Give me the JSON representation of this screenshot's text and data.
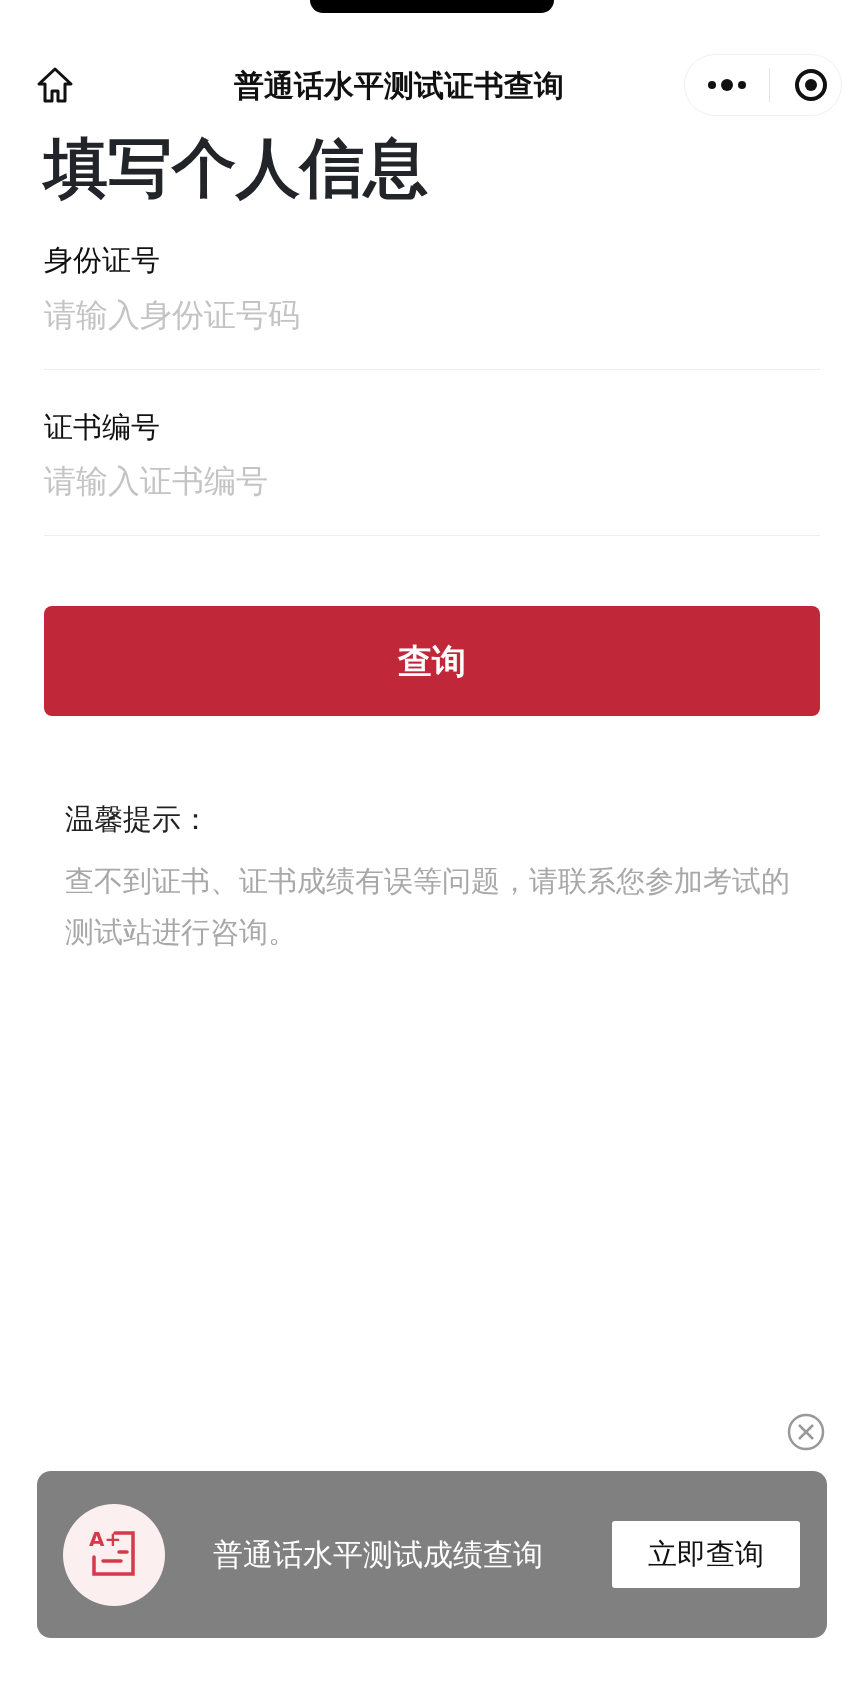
{
  "nav": {
    "title": "普通话水平测试证书查询"
  },
  "heading": "填写个人信息",
  "fields": [
    {
      "label": "身份证号",
      "placeholder": "请输入身份证号码"
    },
    {
      "label": "证书编号",
      "placeholder": "请输入证书编号"
    }
  ],
  "submit": "查询",
  "tip": {
    "title": "温馨提示：",
    "text": "查不到证书、证书成绩有误等问题，请联系您参加考试的测试站进行咨询。"
  },
  "banner": {
    "icon_text": "A+",
    "text": "普通话水平测试成绩查询",
    "button": "立即查询"
  }
}
